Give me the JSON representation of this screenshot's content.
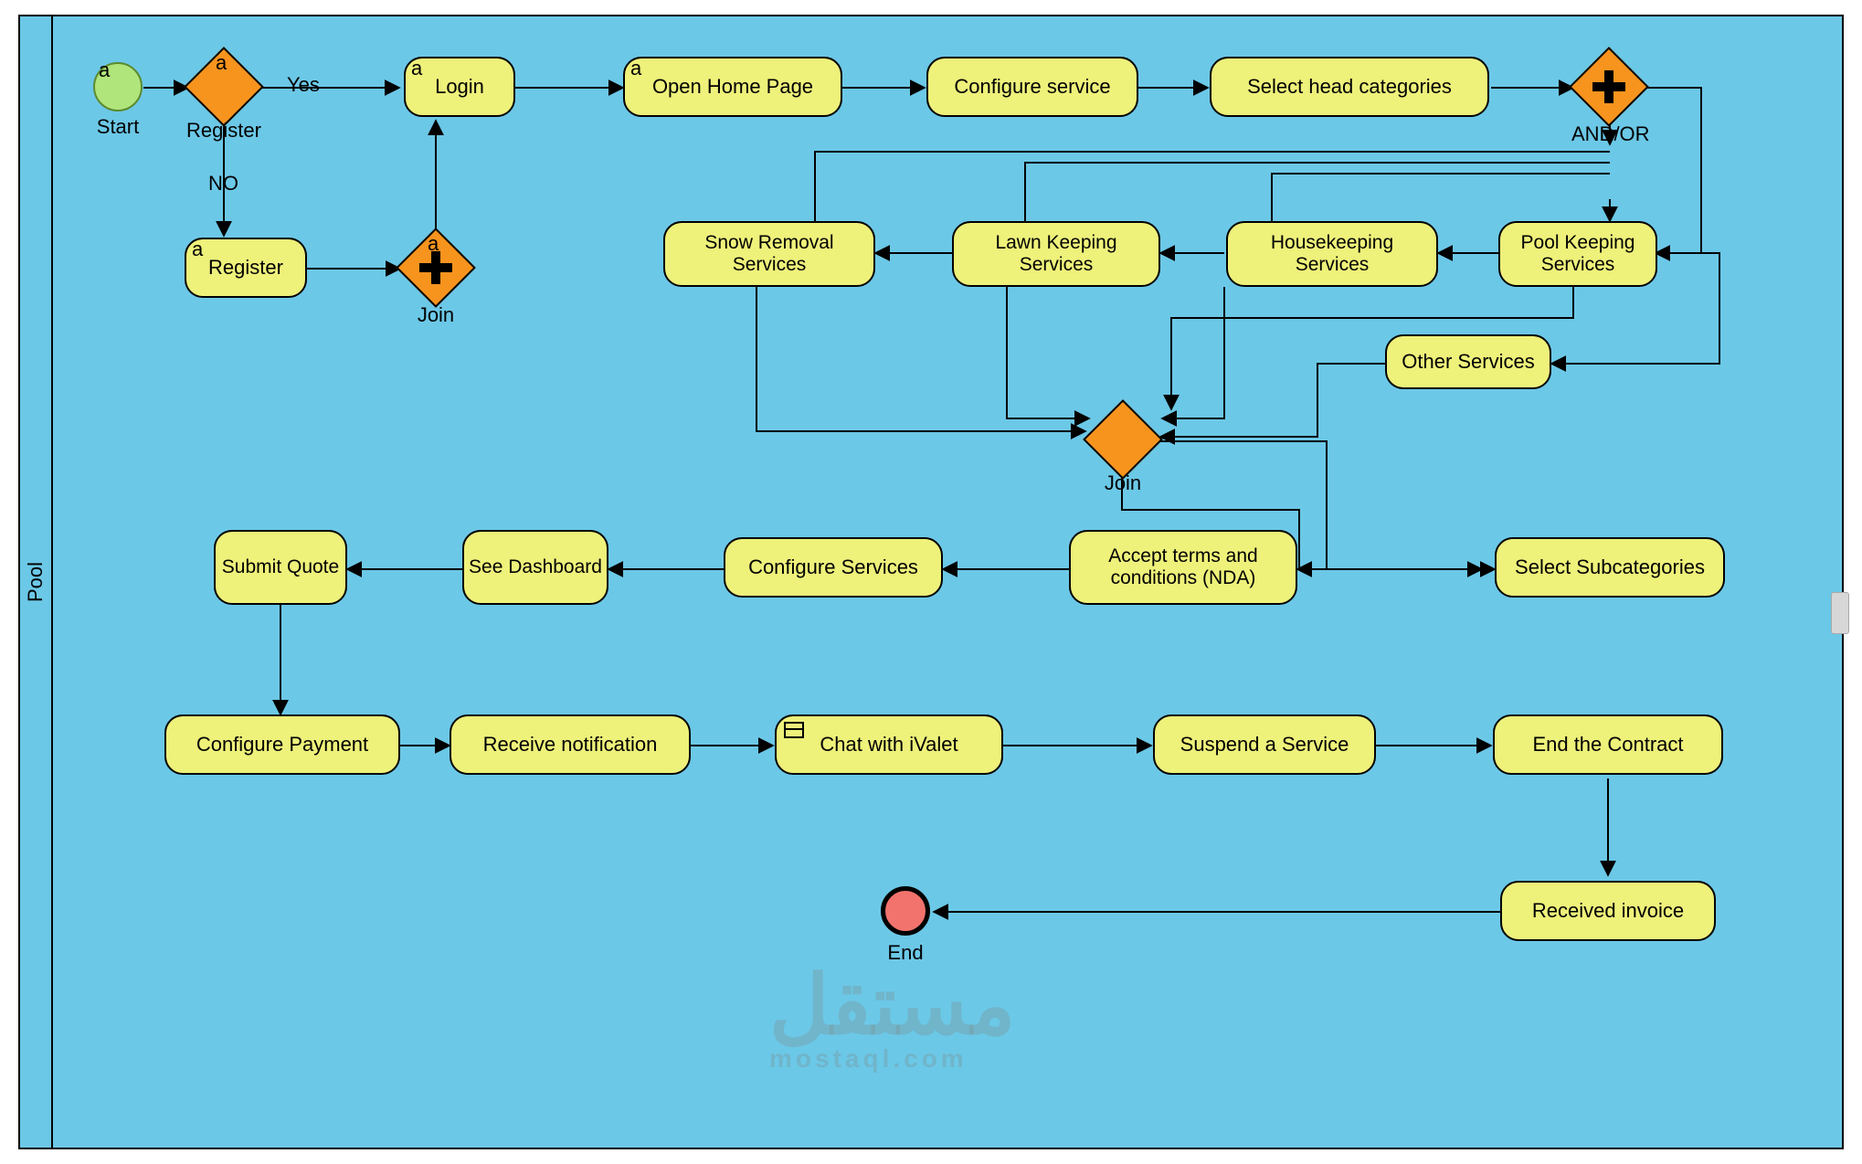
{
  "pool": {
    "label": "Pool"
  },
  "events": {
    "start": {
      "label": "Start",
      "mark": "a"
    },
    "end": {
      "label": "End"
    }
  },
  "gateways": {
    "register": {
      "label": "Register",
      "mark": "a",
      "yes": "Yes",
      "no": "NO"
    },
    "join1": {
      "label": "Join",
      "mark": "a"
    },
    "andor": {
      "label": "AND/OR"
    },
    "join2": {
      "label": "Join"
    }
  },
  "tasks": {
    "login": {
      "label": "Login",
      "mark": "a"
    },
    "open_home": {
      "label": "Open Home Page",
      "mark": "a"
    },
    "configure_service": {
      "label": "Configure service"
    },
    "select_head": {
      "label": "Select head categories"
    },
    "register": {
      "label": "Register",
      "mark": "a"
    },
    "snow": {
      "label": "Snow Removal Services"
    },
    "lawn": {
      "label": "Lawn Keeping Services"
    },
    "house": {
      "label": "Housekeeping Services"
    },
    "pool": {
      "label": "Pool Keeping Services"
    },
    "other": {
      "label": "Other Services"
    },
    "select_sub": {
      "label": "Select Subcategories"
    },
    "accept_terms": {
      "label": "Accept terms and conditions (NDA)"
    },
    "config_svcs": {
      "label": "Configure Services"
    },
    "see_dash": {
      "label": "See Dashboard"
    },
    "submit_quote": {
      "label": "Submit Quote"
    },
    "config_pay": {
      "label": "Configure Payment"
    },
    "recv_notif": {
      "label": "Receive notification"
    },
    "chat": {
      "label": "Chat with iValet"
    },
    "suspend": {
      "label": "Suspend a Service"
    },
    "end_contract": {
      "label": "End the Contract"
    },
    "recv_invoice": {
      "label": "Received invoice"
    }
  },
  "watermark": {
    "main": "مستقل",
    "sub": "mostaql.com"
  }
}
